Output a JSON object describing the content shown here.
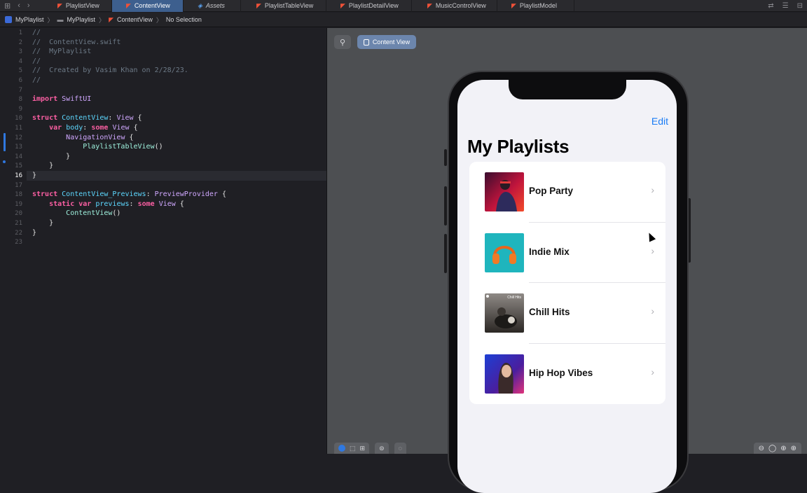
{
  "tabbar": {
    "tabs": [
      {
        "label": "PlaylistView",
        "kind": "swift",
        "active": false
      },
      {
        "label": "ContentView",
        "kind": "swift",
        "active": true
      },
      {
        "label": "Assets",
        "kind": "assets",
        "active": false
      },
      {
        "label": "PlaylistTableView",
        "kind": "swift",
        "active": false
      },
      {
        "label": "PlaylistDetailView",
        "kind": "swift",
        "active": false
      },
      {
        "label": "MusicControlView",
        "kind": "swift",
        "active": false
      },
      {
        "label": "PlaylistModel",
        "kind": "swift",
        "active": false
      }
    ]
  },
  "jumpbar": {
    "project": "MyPlaylist",
    "group": "MyPlaylist",
    "file": "ContentView",
    "selection": "No Selection"
  },
  "editor": {
    "current_line": 16,
    "line_numbers": [
      "1",
      "2",
      "3",
      "4",
      "5",
      "6",
      "7",
      "8",
      "9",
      "10",
      "11",
      "12",
      "13",
      "14",
      "15",
      "16",
      "17",
      "18",
      "19",
      "20",
      "21",
      "22",
      "23"
    ],
    "lines": [
      "//",
      "//  ContentView.swift",
      "//  MyPlaylist",
      "//",
      "//  Created by Vasim Khan on 2/28/23.",
      "//",
      "",
      "import SwiftUI",
      "",
      "struct ContentView: View {",
      "    var body: some View {",
      "        NavigationView {",
      "            PlaylistTableView()",
      "        }",
      "    }",
      "}",
      "",
      "struct ContentView_Previews: PreviewProvider {",
      "    static var previews: some View {",
      "        ContentView()",
      "    }",
      "}",
      ""
    ]
  },
  "canvas": {
    "preview_button_label": "Content View"
  },
  "app": {
    "edit_label": "Edit",
    "nav_title": "My Playlists",
    "playlists": [
      {
        "name": "Pop Party"
      },
      {
        "name": "Indie Mix"
      },
      {
        "name": "Chill Hits"
      },
      {
        "name": "Hip Hop Vibes"
      }
    ],
    "thumb_caption": "Chill Hits"
  },
  "colors": {
    "active_tab": "#3d5f8e",
    "ios_tint": "#1a7cf5",
    "canvas_bg": "#4d4f52"
  }
}
